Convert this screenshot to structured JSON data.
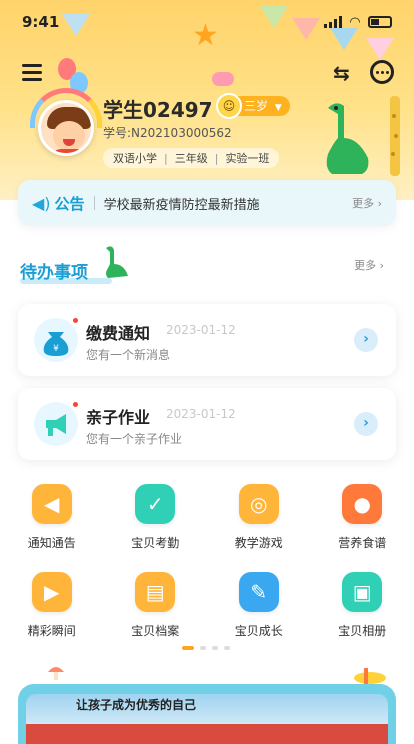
{
  "status_bar": {
    "time": "9:41"
  },
  "profile": {
    "name": "学生02497",
    "age": "三岁",
    "student_no": "学号:N202103000562",
    "tags": [
      "双语小学",
      "三年级",
      "实验一班"
    ]
  },
  "notice": {
    "title": "公告",
    "text": "学校最新疫情防控最新措施",
    "more": "更多 ›"
  },
  "todo": {
    "title": "待办事项",
    "more": "更多 ›",
    "items": [
      {
        "title": "缴费通知",
        "date": "2023-01-12",
        "desc": "您有一个新消息",
        "icon": "money-bag-icon"
      },
      {
        "title": "亲子作业",
        "date": "2023-01-12",
        "desc": "您有一个亲子作业",
        "icon": "megaphone-icon"
      }
    ]
  },
  "grid": [
    {
      "label": "通知通告",
      "icon": "speaker-icon",
      "color": "#ffb43a"
    },
    {
      "label": "宝贝考勤",
      "icon": "check-in-icon",
      "color": "#2fd0b5"
    },
    {
      "label": "教学游戏",
      "icon": "gamepad-icon",
      "color": "#ffb43a"
    },
    {
      "label": "营养食谱",
      "icon": "food-icon",
      "color": "#ff7a3a"
    },
    {
      "label": "精彩瞬间",
      "icon": "video-icon",
      "color": "#ffb43a"
    },
    {
      "label": "宝贝档案",
      "icon": "archive-icon",
      "color": "#ffb43a"
    },
    {
      "label": "宝贝成长",
      "icon": "growth-icon",
      "color": "#3aa8f0"
    },
    {
      "label": "宝贝相册",
      "icon": "album-icon",
      "color": "#2fd0b5"
    }
  ],
  "banner": {
    "text": "让孩子成为优秀的自己"
  }
}
